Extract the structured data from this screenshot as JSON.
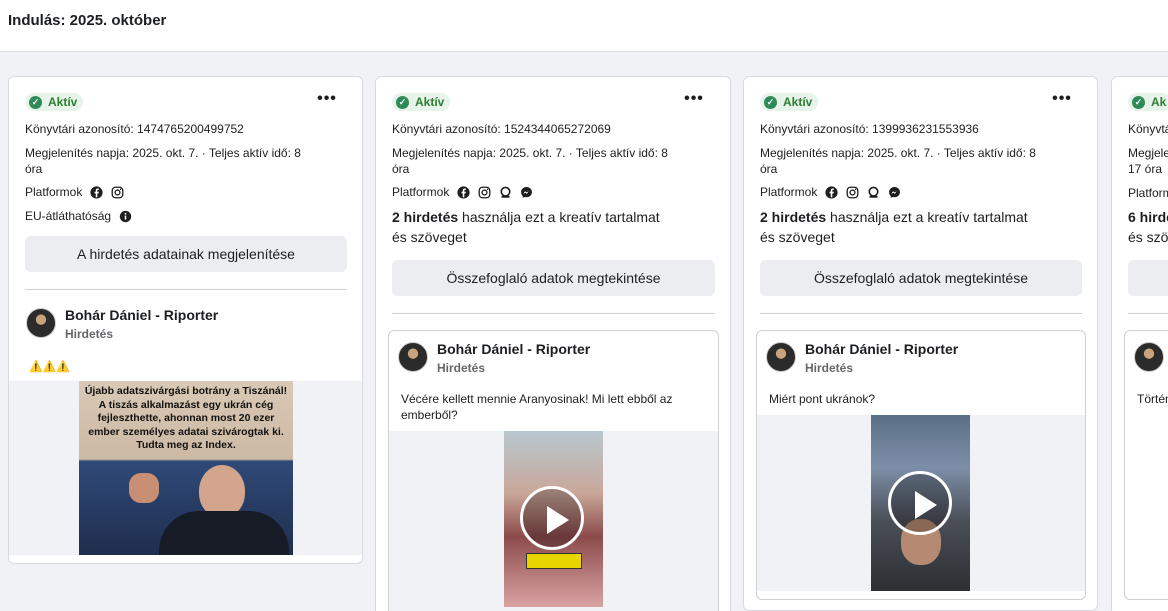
{
  "header": {
    "title": "Indulás: 2025. október"
  },
  "status": {
    "label": "Aktív",
    "color": "#2e7d32"
  },
  "labels": {
    "library_id_prefix": "Könyvtári azonosító: ",
    "platforms": "Platformok",
    "eu": "EU-átláthatóság",
    "show_details": "A hirdetés adatainak megjelenítése",
    "summary": "Összefoglaló adatok megtekintése",
    "uses_text": " használja ezt a kreatív tartalmat és szöveget"
  },
  "cards": [
    {
      "library_id": "Könyvtári azonosító: 1474765200499752",
      "date_line1": "Megjelenítés napja: 2025. okt. 7. · Teljes aktív idő: 8",
      "date_line2": "óra",
      "platform_icons": [
        "facebook-icon",
        "instagram-icon"
      ],
      "eu": "EU-átláthatóság",
      "button": "A hirdetés adatainak megjelenítése",
      "advertiser": "Bohár Dániel - Riporter",
      "sponsored": "Hirdetés",
      "ad_text": "⚠️⚠️⚠️",
      "image_text": "Újabb adatszivárgási botrány a Tiszánál! A tiszás alkalmazást egy ukrán cég fejleszthette, ahonnan most 20 ezer ember személyes adatai szivárogtak ki. Tudta meg az Index."
    },
    {
      "library_id": "Könyvtári azonosító: 1524344065272069",
      "date_line1": "Megjelenítés napja: 2025. okt. 7. · Teljes aktív idő: 8",
      "date_line2": "óra",
      "platform_icons": [
        "facebook-icon",
        "instagram-icon",
        "audience-network-icon",
        "messenger-icon"
      ],
      "count_bold": "2 hirdetés",
      "count_rest": " használja ezt a kreatív tartalmat",
      "count_line2": "és szöveget",
      "button": "Összefoglaló adatok megtekintése",
      "advertiser": "Bohár Dániel - Riporter",
      "sponsored": "Hirdetés",
      "ad_text_line1": "Vécére kellett mennie Aranyosinak! Mi lett ebből az",
      "ad_text_line2": "emberből?"
    },
    {
      "library_id": "Könyvtári azonosító: 1399936231553936",
      "date_line1": "Megjelenítés napja: 2025. okt. 7. · Teljes aktív idő: 8",
      "date_line2": "óra",
      "platform_icons": [
        "facebook-icon",
        "instagram-icon",
        "audience-network-icon",
        "messenger-icon"
      ],
      "count_bold": "2 hirdetés",
      "count_rest": " használja ezt a kreatív tartalmat",
      "count_line2": "és szöveget",
      "button": "Összefoglaló adatok megtekintése",
      "advertiser": "Bohár Dániel - Riporter",
      "sponsored": "Hirdetés",
      "ad_text_line1": "Miért pont ukránok?"
    },
    {
      "badge_partial": "Ak",
      "library_partial": "Könyvtá",
      "date_partial": "Megjele",
      "date_partial2": "17 óra",
      "platforms_partial": "Platform",
      "count_partial": "6 hirde",
      "count_partial2": "és szö",
      "text_partial": "Történ"
    }
  ]
}
